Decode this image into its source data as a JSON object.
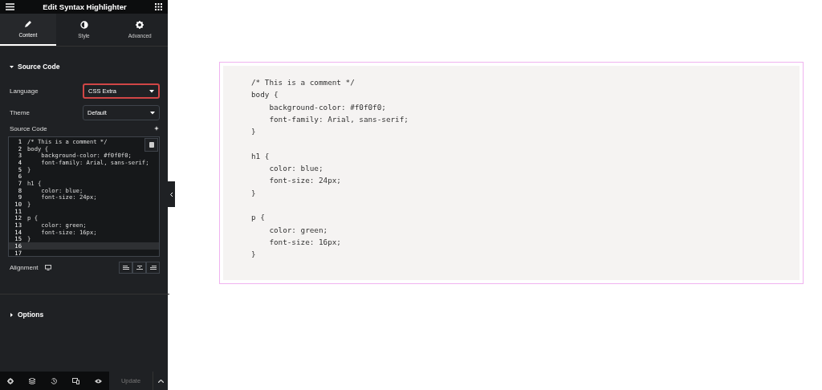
{
  "panel": {
    "title": "Edit Syntax Highlighter",
    "tabs": [
      {
        "label": "Content",
        "selected": true
      },
      {
        "label": "Style",
        "selected": false
      },
      {
        "label": "Advanced",
        "selected": false
      }
    ],
    "sections": [
      {
        "title": "Source Code",
        "expanded": true
      },
      {
        "title": "Options",
        "expanded": false
      }
    ],
    "language": {
      "label": "Language",
      "value": "CSS Extra",
      "focused": true
    },
    "theme": {
      "label": "Theme",
      "value": "Default",
      "focused": false
    },
    "source_label": "Source Code",
    "editor_lines": [
      {
        "number": "1",
        "text": "/* This is a comment */",
        "current": false
      },
      {
        "number": "2",
        "text": "body {",
        "current": false
      },
      {
        "number": "3",
        "text": "    background-color: #f0f0f0;",
        "current": false
      },
      {
        "number": "4",
        "text": "    font-family: Arial, sans-serif;",
        "current": false
      },
      {
        "number": "5",
        "text": "}",
        "current": false
      },
      {
        "number": "6",
        "current": false
      },
      {
        "number": "7",
        "text": "h1 {",
        "current": false
      },
      {
        "number": "8",
        "text": "    color: blue;",
        "current": false
      },
      {
        "number": "9",
        "text": "    font-size: 24px;",
        "current": false
      },
      {
        "number": "10",
        "text": "}",
        "current": false
      },
      {
        "number": "11",
        "current": false
      },
      {
        "number": "12",
        "text": "p {",
        "current": false
      },
      {
        "number": "13",
        "text": "    color: green;",
        "current": false
      },
      {
        "number": "14",
        "text": "    font-size: 16px;",
        "current": false
      },
      {
        "number": "15",
        "text": "}",
        "current": false
      },
      {
        "number": "16",
        "current": true
      },
      {
        "number": "17",
        "current": false
      }
    ],
    "alignment_label": "Alignment",
    "update": {
      "label": "Update",
      "disabled": true
    }
  },
  "preview": {
    "blocks": [
      [
        "/* This is a comment */",
        "body {",
        "    background-color: #f0f0f0;",
        "    font-family: Arial, sans-serif;",
        "}"
      ],
      [
        "h1 {",
        "    color: blue;",
        "    font-size: 24px;",
        "}"
      ],
      [
        "p {",
        "    color: green;",
        "    font-size: 16px;",
        "}"
      ]
    ]
  }
}
